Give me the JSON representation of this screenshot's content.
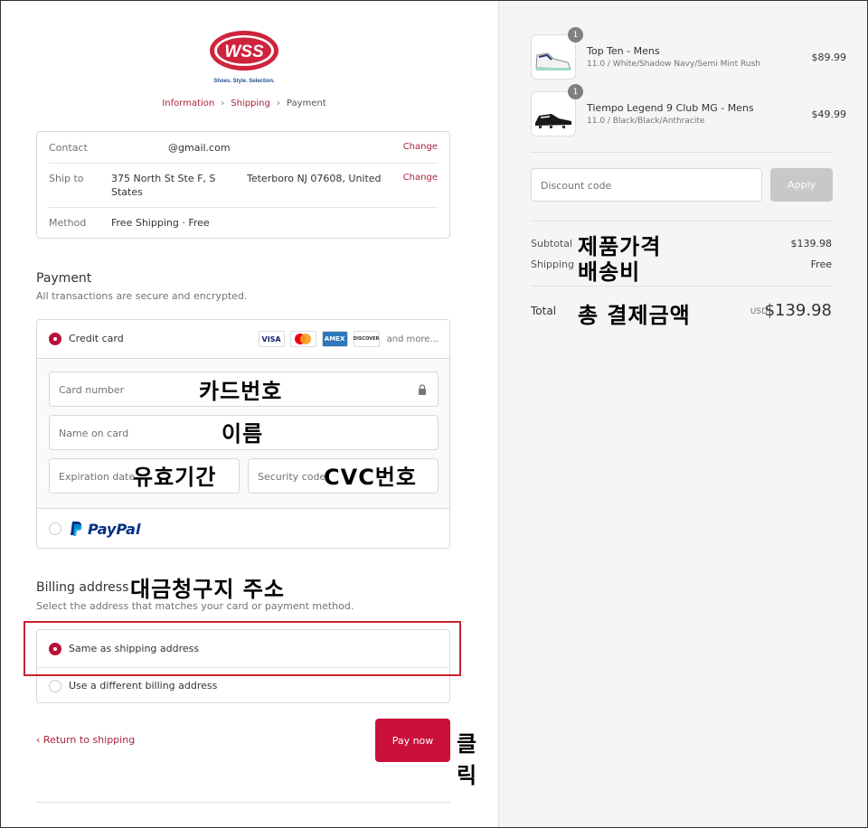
{
  "brand": {
    "logo_text": "WSS",
    "tagline": "Shoes. Style. Selection."
  },
  "breadcrumb": {
    "info": "Information",
    "shipping": "Shipping",
    "payment": "Payment"
  },
  "info": {
    "contact_label": "Contact",
    "contact_value": "@gmail.com",
    "change_label": "Change",
    "ship_label": "Ship to",
    "ship_line1": "375 North St Ste F, S",
    "ship_line1b": "States",
    "ship_line2": "Teterboro NJ 07608, United",
    "method_label": "Method",
    "method_value": "Free Shipping · Free"
  },
  "payment": {
    "title": "Payment",
    "subtitle": "All transactions are secure and encrypted.",
    "credit_card_label": "Credit card",
    "cards": [
      "VISA",
      "MC",
      "AMEX",
      "DISCOVER"
    ],
    "and_more": "and more...",
    "card_number_ph": "Card number",
    "name_ph": "Name on card",
    "exp_ph": "Expiration date",
    "cvc_ph": "Security code",
    "paypal_label": "PayPal"
  },
  "billing": {
    "title": "Billing address",
    "subtitle": "Select the address that matches your card or payment method.",
    "same": "Same as shipping address",
    "different": "Use a different billing address"
  },
  "actions": {
    "return": "Return to shipping",
    "pay": "Pay now"
  },
  "annotations": {
    "card_number": "카드번호",
    "name": "이름",
    "expiry": "유효기간",
    "cvc": "CVC번호",
    "billing": "대금청구지 주소",
    "click": "클릭",
    "subtotal": "제품가격",
    "shipping": "배송비",
    "total": "총 결제금액"
  },
  "order": {
    "items": [
      {
        "qty": "1",
        "name": "Top Ten - Mens",
        "variant": "11.0 / White/Shadow Navy/Semi Mint Rush",
        "price": "$89.99"
      },
      {
        "qty": "1",
        "name": "Tiempo Legend 9 Club MG - Mens",
        "variant": "11.0 / Black/Black/Anthracite",
        "price": "$49.99"
      }
    ],
    "discount_ph": "Discount code",
    "apply": "Apply",
    "subtotal_label": "Subtotal",
    "subtotal_value": "$139.98",
    "shipping_label": "Shipping",
    "shipping_value": "Free",
    "total_label": "Total",
    "currency": "USD",
    "total_value": "$139.98"
  },
  "colors": {
    "accent": "#c8103a",
    "link": "#a8243c",
    "highlight": "#c8232c"
  }
}
